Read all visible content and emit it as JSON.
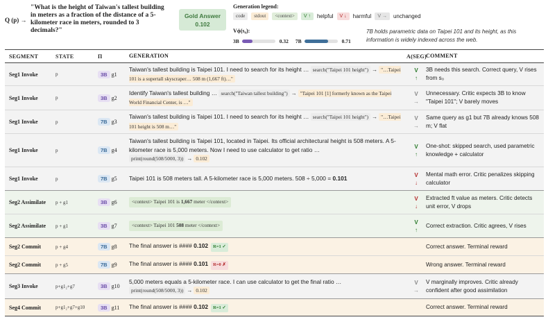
{
  "header": {
    "q_label": "Q (p) →",
    "question": "\"What is the height of Taiwan's tallest building in meters as a fraction of the distance of a 5-kilometer race in meters, rounded to 3 decimals?\"",
    "gold_label": "Gold Answer",
    "gold_value": "0.102",
    "legend_title": "Generation legend:",
    "legend_chips": [
      "code",
      "stdout",
      "<context>"
    ],
    "legend_v": [
      {
        "chip": "V ↑",
        "label": "helpful"
      },
      {
        "chip": "V ↓",
        "label": "harmful"
      },
      {
        "chip": "V →",
        "label": "unchanged"
      }
    ],
    "v_title": "Vϕ(s₀):",
    "v_bars": [
      {
        "name": "3B",
        "value": 0.32,
        "value_text": "0.32",
        "color": "#7a5bb5"
      },
      {
        "name": "7B",
        "value": 0.71,
        "value_text": "0.71",
        "color": "#3f6f99"
      }
    ],
    "note": "7B holds parametric data on Taipei 101 and its height, as this information is widely indexed across the web."
  },
  "table": {
    "columns": [
      "SEGMENT",
      "STATE",
      "Π",
      "GENERATION",
      "A(SEG)",
      "COMMENT"
    ],
    "rows": [
      {
        "segment": "Seg1 Invoke",
        "state": "p",
        "policy": "3B",
        "g": "g1",
        "text": "Taiwan's tallest building is Taipei 101. I need to search for its height …",
        "code": "search(\"Taipei 101 height\")",
        "stdout": "\"…Taipei 101 is a supertall skyscraper… 508 m (1,667 ft)…\"",
        "a_sym": "V",
        "a_arrow": "↑",
        "comment": "3B needs this search. Correct query, V rises from s₀"
      },
      {
        "segment": "Seg1 Invoke",
        "state": "p",
        "policy": "3B",
        "g": "g2",
        "text": "Identify Taiwan's tallest building …",
        "code": "search(\"Taiwan tallest building\")",
        "stdout": "\"Taipei 101 [1] formerly known as the Taipei World Financial Center, is …\"",
        "a_sym": "V",
        "a_arrow": "→",
        "comment": "Unnecessary. Critic expects 3B to know \"Taipei 101\"; V barely moves"
      },
      {
        "segment": "Seg1 Invoke",
        "state": "p",
        "policy": "7B",
        "g": "g3",
        "text": "Taiwan's tallest building is Taipei 101. I need to search for its height …",
        "code": "search(\"Taipei 101 height\")",
        "stdout": "\"…Taipei 101 height is 508 m…\"",
        "a_sym": "V",
        "a_arrow": "→",
        "comment": "Same query as g1 but 7B already knows 508 m; V flat"
      },
      {
        "segment": "Seg1 Invoke",
        "state": "p",
        "policy": "7B",
        "g": "g4",
        "text": "Taiwan's tallest building is Taipei 101, located in Taipei. Its official architectural height is 508 meters. A 5-kilometer race is 5,000 meters. Now I need to use calculator to get ratio …",
        "code": "print(round(508/5000, 3))",
        "stdout": "0.102",
        "a_sym": "V",
        "a_arrow": "↑",
        "comment": "One-shot: skipped search, used parametric knowledge + calculator"
      },
      {
        "segment": "Seg1 Invoke",
        "state": "p",
        "policy": "7B",
        "g": "g5",
        "text": "Taipei 101 is 508 meters tall. A 5-kilometer race is 5,000 meters. 508 ÷ 5,000 = ",
        "bold": "0.101",
        "a_sym": "V",
        "a_arrow": "↓",
        "comment": "Mental math error. Critic penalizes skipping calculator"
      },
      {
        "segment": "Seg2 Assimilate",
        "state": "p + g1",
        "policy": "3B",
        "g": "g6",
        "ctx_pre": "<context> Taipei 101 is ",
        "ctx_bold": "1,667",
        "ctx_post": " meter </context>",
        "a_sym": "V",
        "a_arrow": "↓",
        "comment": "Extracted ft value as meters. Critic detects unit error, V drops"
      },
      {
        "segment": "Seg2 Assimilate",
        "state": "p + g1",
        "policy": "3B",
        "g": "g7",
        "ctx_pre": "<context> Taipei 101 ",
        "ctx_bold": "508",
        "ctx_post": " meter </context>",
        "a_sym": "V",
        "a_arrow": "↑",
        "comment": "Correct extraction. Critic agrees, V rises"
      },
      {
        "segment": "Seg2 Commit",
        "state": "p + g4",
        "policy": "7B",
        "g": "g8",
        "text": "The final answer is #### ",
        "bold": "0.102",
        "reward": "R=1 ✓",
        "comment": "Correct answer. Terminal reward"
      },
      {
        "segment": "Seg2 Commit",
        "state": "p + g5",
        "policy": "7B",
        "g": "g9",
        "text": "The final answer is #### ",
        "bold": "0.101",
        "reward": "R=0 ✗",
        "comment": "Wrong answer. Terminal reward"
      },
      {
        "segment": "Seg3 Invoke",
        "state": "p+g1₂+g7",
        "policy": "3B",
        "g": "g10",
        "text": "5,000 meters equals a 5-kilometer race. I can use calculator to get the final ratio …",
        "code": "print(round(508/5000, 3))",
        "stdout": "0.102",
        "a_sym": "V",
        "a_arrow": "→",
        "comment": "V marginally improves. Critic already confident after good assimilation"
      },
      {
        "segment": "Seg4 Commit",
        "state": "p+g1₂+g7+g10",
        "policy": "3B",
        "g": "g11",
        "text": "The final answer is #### ",
        "bold": "0.102",
        "reward": "R=1 ✓",
        "comment": "Correct answer. Terminal reward"
      }
    ]
  }
}
